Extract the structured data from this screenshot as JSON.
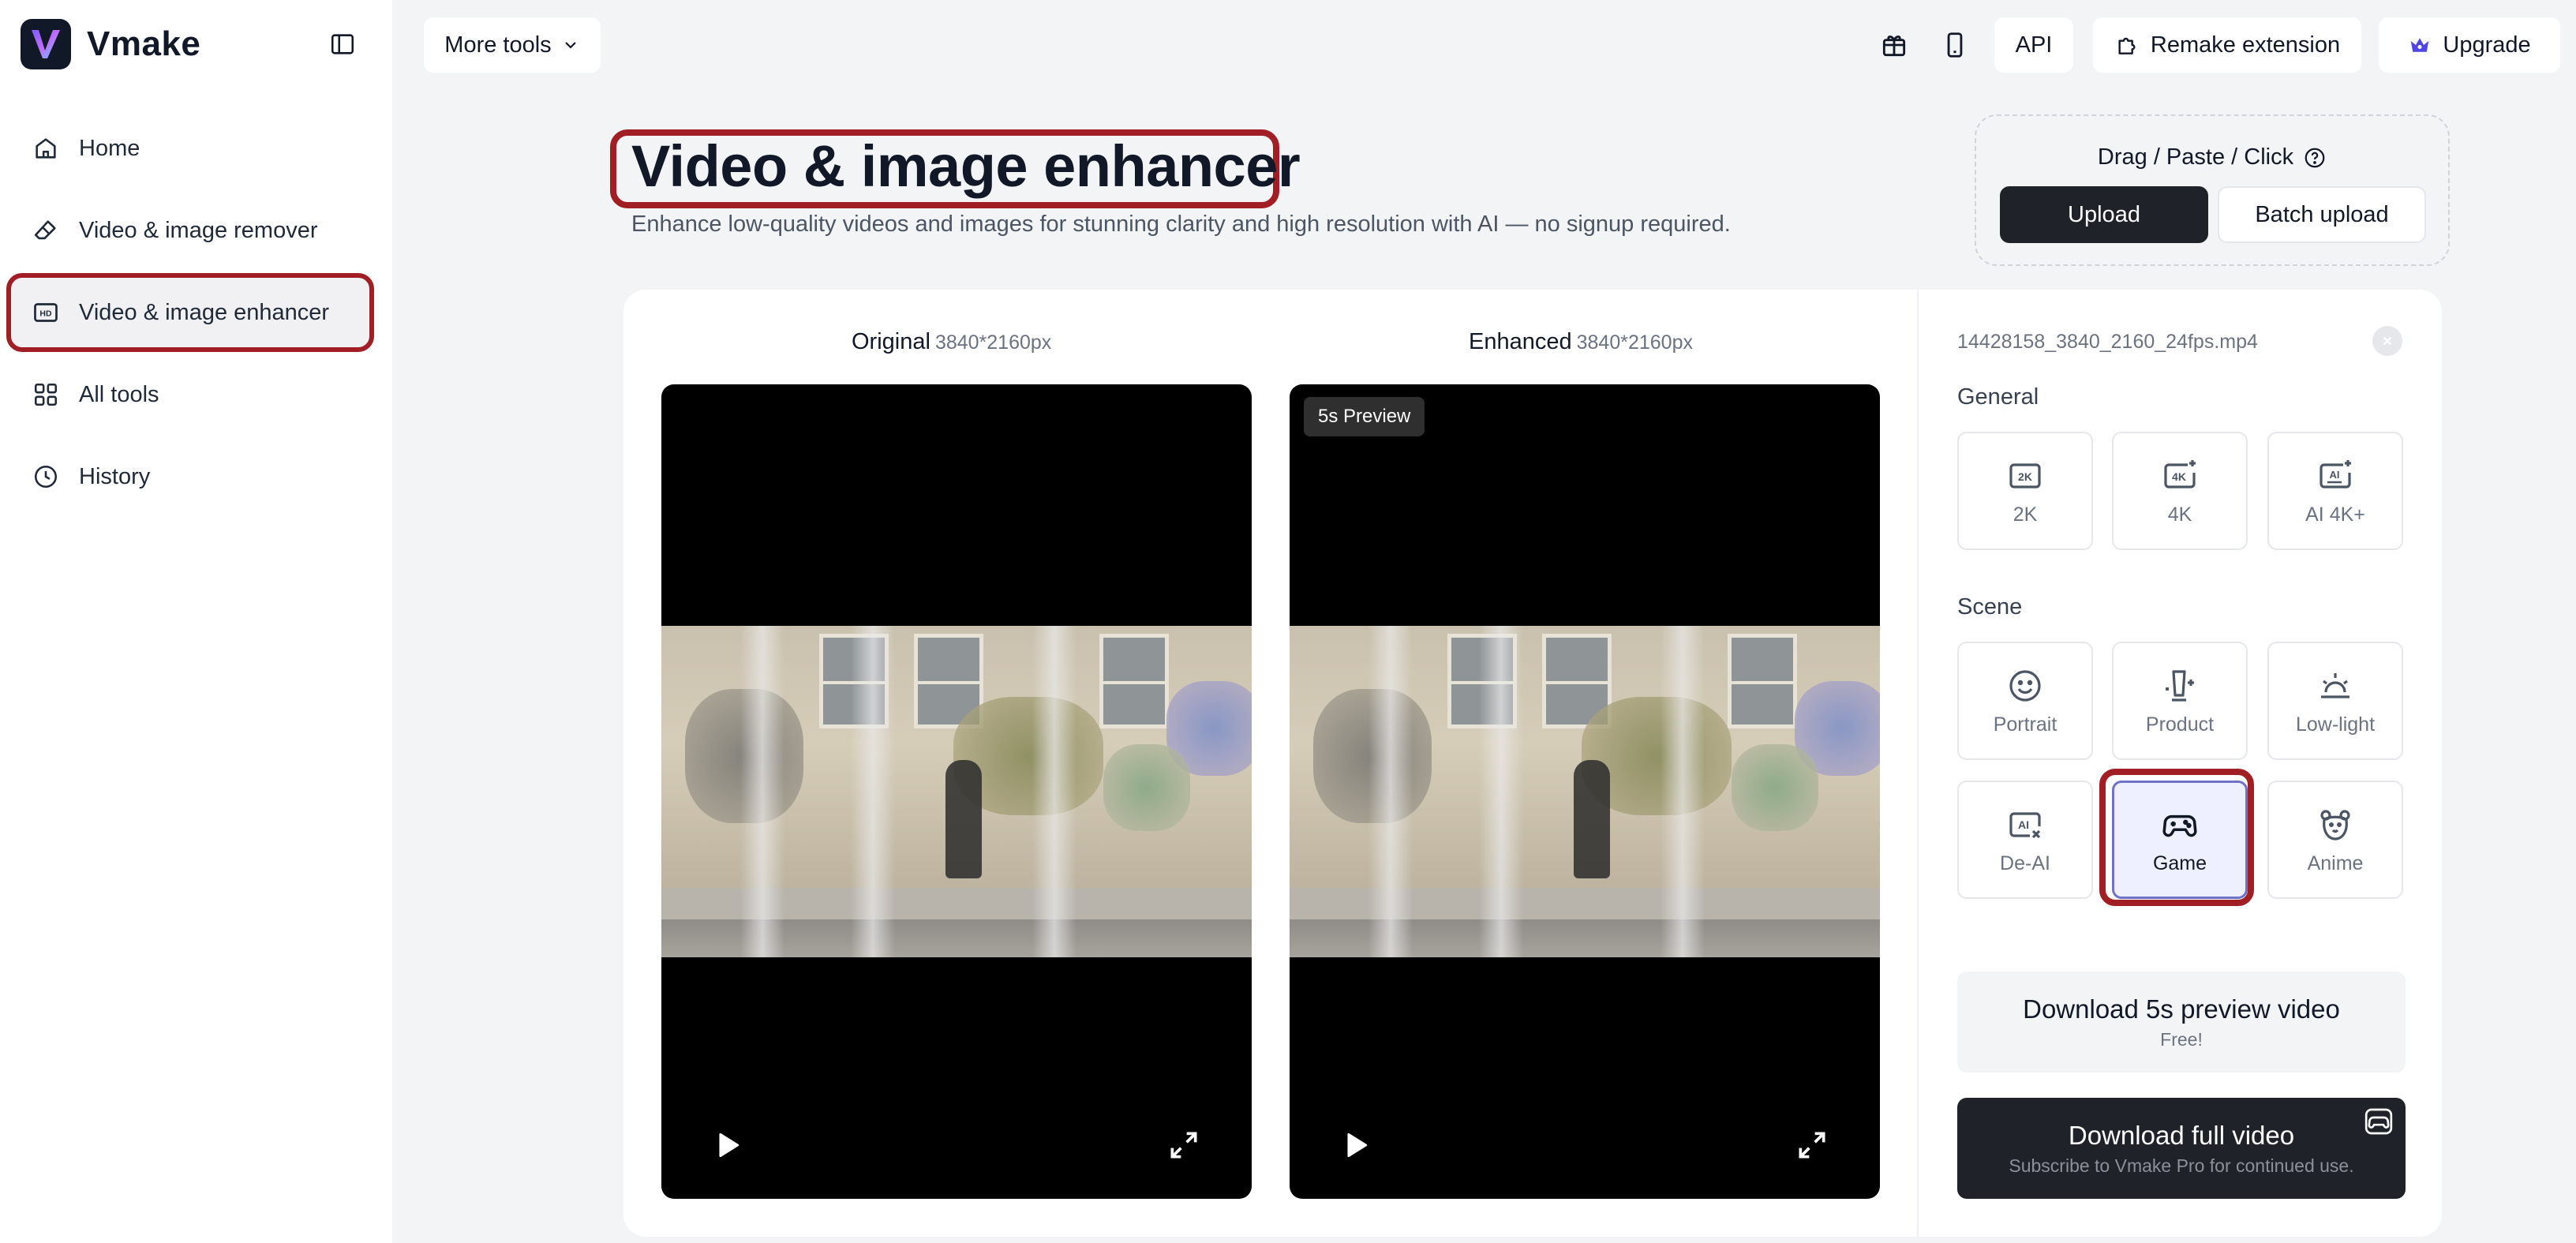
{
  "sidebar": {
    "brand": "Vmake",
    "items": [
      {
        "label": "Home",
        "icon": "home-icon"
      },
      {
        "label": "Video & image remover",
        "icon": "eraser-icon"
      },
      {
        "label": "Video & image enhancer",
        "icon": "hd-icon",
        "active": true
      },
      {
        "label": "All tools",
        "icon": "grid-icon"
      },
      {
        "label": "History",
        "icon": "clock-icon"
      }
    ]
  },
  "topbar": {
    "more_tools": "More tools",
    "api": "API",
    "remake_extension": "Remake extension",
    "upgrade": "Upgrade"
  },
  "hero": {
    "title": "Video & image enhancer",
    "subtitle": "Enhance low-quality videos and images for stunning clarity and high resolution with AI — no signup required."
  },
  "upload": {
    "hint": "Drag / Paste / Click",
    "upload_label": "Upload",
    "batch_label": "Batch upload"
  },
  "compare": {
    "original_label": "Original",
    "original_dims": "3840*2160px",
    "enhanced_label": "Enhanced",
    "enhanced_dims": "3840*2160px",
    "preview_badge": "5s Preview"
  },
  "panel": {
    "filename": "14428158_3840_2160_24fps.mp4",
    "general_label": "General",
    "general_options": [
      {
        "label": "2K",
        "icon_text": "2K"
      },
      {
        "label": "4K",
        "icon_text": "4K"
      },
      {
        "label": "AI 4K+",
        "icon_text": "AI"
      }
    ],
    "scene_label": "Scene",
    "scene_options": [
      {
        "label": "Portrait"
      },
      {
        "label": "Product"
      },
      {
        "label": "Low-light"
      },
      {
        "label": "De-AI",
        "icon_text": "AI"
      },
      {
        "label": "Game",
        "selected": true
      },
      {
        "label": "Anime"
      }
    ],
    "download_preview": {
      "label": "Download 5s preview video",
      "sub": "Free!"
    },
    "download_full": {
      "label": "Download full video",
      "sub": "Subscribe to Vmake Pro for continued use."
    }
  },
  "colors": {
    "accent_dark": "#1f2329",
    "highlight": "#a11f24",
    "selected_bg": "#eef0ff",
    "upgrade_icon": "#4f46e5"
  }
}
